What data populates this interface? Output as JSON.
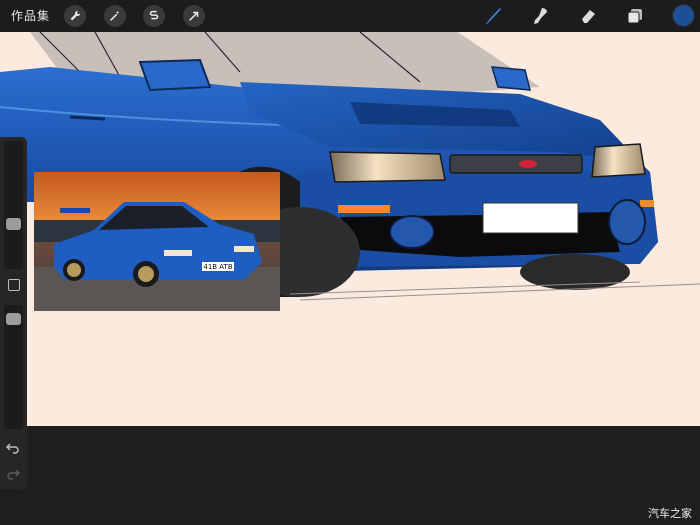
{
  "toolbar": {
    "gallery_label": "作品集",
    "left_tools": [
      "wrench-icon",
      "magic-wand-icon",
      "selection-icon",
      "transform-arrow-icon"
    ],
    "right_tools": [
      "brush-icon",
      "smudge-icon",
      "eraser-icon",
      "layers-icon"
    ],
    "active_color": "#1d4f93"
  },
  "sidebar": {
    "brush_size_level": 0.25,
    "opacity_level": 0.05
  },
  "reference_image": {
    "plate_text": "41B ATB"
  },
  "watermark": "汽车之家",
  "colors": {
    "canvas": "#fbeade",
    "car_blue": "#1e5bb8",
    "ui_dark": "#1c1c1c"
  }
}
